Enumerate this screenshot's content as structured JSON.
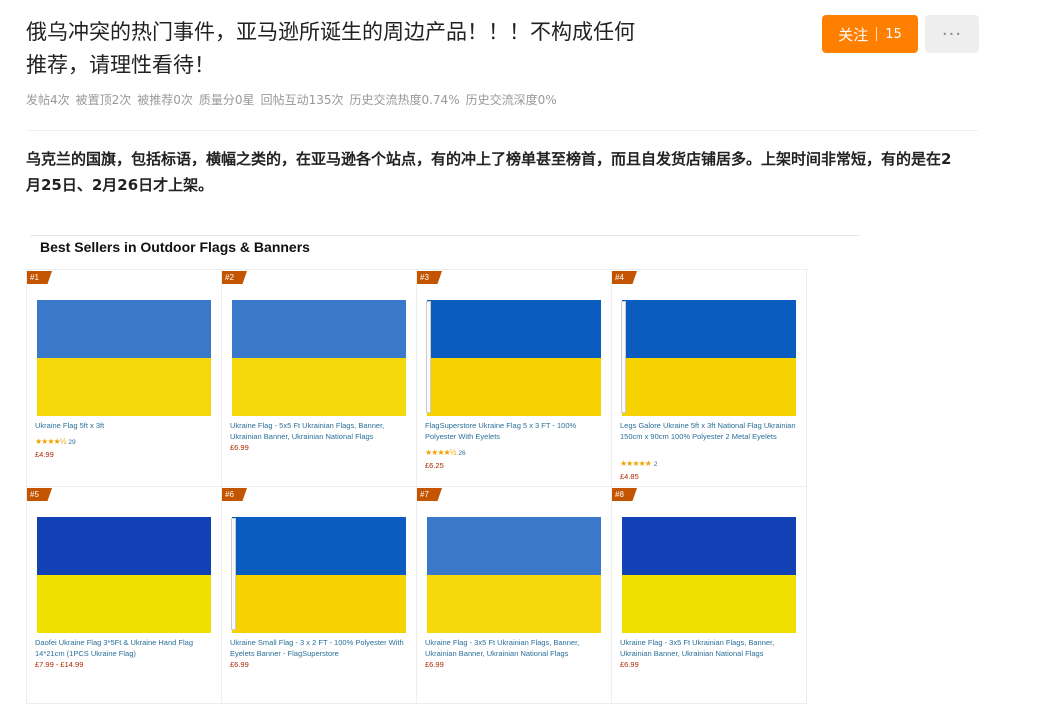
{
  "post": {
    "title": "俄乌冲突的热门事件，亚马逊所诞生的周边产品！！！不构成任何推荐，请理性看待！",
    "follow_label": "关注",
    "follow_count": "15",
    "more_label": "···",
    "stats": [
      "发帖4次",
      "被置顶2次",
      "被推荐0次",
      "质量分0星",
      "回帖互动135次",
      "历史交流热度0.74%",
      "历史交流深度0%"
    ],
    "body": "乌克兰的国旗，包括标语，横幅之类的，在亚马逊各个站点，有的冲上了榜单甚至榜首，而且自发货店铺居多。上架时间非常短，有的是在2月25日、2月26日才上架。"
  },
  "bestsellers": {
    "heading": "Best Sellers in Outdoor Flags & Banners",
    "colors": {
      "rank_bg": "#c45500",
      "link": "#2a6f99",
      "price": "#b12704",
      "star": "#f0a200"
    },
    "products": [
      {
        "rank": "#1",
        "title": "Ukraine Flag 5ft x 3ft",
        "stars": "★★★★½",
        "reviews": "29",
        "price": "£4.99",
        "blue": "#3a78c9",
        "yellow": "#f5d90a",
        "pole": false
      },
      {
        "rank": "#2",
        "title": "Ukraine Flag - 5x5 Ft Ukrainian Flags, Banner, Ukrainian Banner, Ukrainian National Flags",
        "stars": "",
        "reviews": "",
        "price": "£6.99",
        "blue": "#3a78c9",
        "yellow": "#f5d90a",
        "pole": false
      },
      {
        "rank": "#3",
        "title": "FlagSuperstore Ukraine Flag 5 x 3 FT - 100% Polyester With Eyelets",
        "stars": "★★★★½",
        "reviews": "26",
        "price": "£6.25",
        "blue": "#0b5cbf",
        "yellow": "#f6d200",
        "pole": true
      },
      {
        "rank": "#4",
        "title": "Legs Galore Ukraine 5ft x 3ft National Flag Ukrainian 150cm x 90cm 100% Polyester 2 Metal Eyelets",
        "stars": "★★★★★",
        "reviews": "2",
        "price": "£4.85",
        "blue": "#0b5cbf",
        "yellow": "#f6d200",
        "pole": true
      },
      {
        "rank": "#5",
        "title": "Daofei Ukraine Flag 3*5Ft & Ukraine Hand Flag 14*21cm (1PCS Ukraine Flag)",
        "stars": "",
        "reviews": "",
        "price": "£7.99 - £14.99",
        "blue": "#1141b4",
        "yellow": "#f0e000",
        "pole": false
      },
      {
        "rank": "#6",
        "title": "Ukraine Small Flag - 3 x 2 FT - 100% Polyester With Eyelets Banner - FlagSuperstore",
        "stars": "",
        "reviews": "",
        "price": "£6.99",
        "blue": "#0b5cbf",
        "yellow": "#f6d200",
        "pole": true
      },
      {
        "rank": "#7",
        "title": "Ukraine Flag - 3x5 Ft Ukrainian Flags, Banner, Ukrainian Banner, Ukrainian National Flags",
        "stars": "",
        "reviews": "",
        "price": "£6.99",
        "blue": "#3a78c9",
        "yellow": "#f5d90a",
        "pole": false
      },
      {
        "rank": "#8",
        "title": "Ukraine Flag - 3x5 Ft Ukrainian Flags, Banner, Ukrainian Banner, Ukrainian National Flags",
        "stars": "",
        "reviews": "",
        "price": "£6.99",
        "blue": "#1141b4",
        "yellow": "#f0e000",
        "pole": false
      }
    ]
  }
}
